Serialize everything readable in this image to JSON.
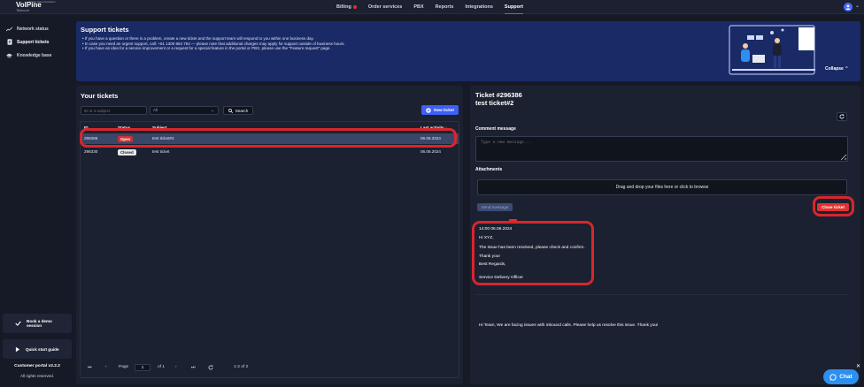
{
  "brand": {
    "name": "VolPine",
    "sub": "Telecom",
    "tag": "Smart Communication"
  },
  "nav": {
    "items": [
      {
        "label": "Billing",
        "dot": true
      },
      {
        "label": "Order services"
      },
      {
        "label": "PBX"
      },
      {
        "label": "Reports"
      },
      {
        "label": "Integrations"
      },
      {
        "label": "Support",
        "active": true
      }
    ]
  },
  "sidebar": {
    "items": [
      {
        "label": "Network status",
        "icon": "chart-line-icon"
      },
      {
        "label": "Support tickets",
        "icon": "ticket-icon",
        "active": true
      },
      {
        "label": "Knowledge base",
        "icon": "graduation-cap-icon"
      }
    ],
    "demo_label": "Book a demo session",
    "guide_label": "Quick start guide",
    "version": "Customer portal v2.2.2",
    "rights": "All rights reserved."
  },
  "banner": {
    "title": "Support tickets",
    "lines": [
      "If you have a question or there is a problem, create a new ticket and the support team will respond to you within one business day.",
      "In case you need an urgent support, call: +61 1300 864 754 — please note that additional charges may apply for support outside of business hours.",
      "If you have an idea for a service improvement or a request for a special feature in the portal or PBX, please use the \"Feature request\" page."
    ],
    "collapse_label": "Collapse"
  },
  "tickets": {
    "title": "Your tickets",
    "search_placeholder": "ID or a subject",
    "status_filter": "All",
    "search_label": "Search",
    "new_ticket_label": "New ticket",
    "columns": {
      "id": "ID",
      "status": "Status",
      "subject": "Subject",
      "last_activity": "Last activity"
    },
    "rows": [
      {
        "id": "296386",
        "status": "Open",
        "subject": "test ticket#2",
        "last_activity": "06.06.2024"
      },
      {
        "id": "296330",
        "status": "Closed",
        "subject": "test ticket",
        "last_activity": "06.06.2024"
      }
    ],
    "pager": {
      "page_label": "Page",
      "page": "1",
      "of_label": "of 1",
      "range": "1-2 of 2"
    }
  },
  "detail": {
    "ticket_id": "Ticket #296386",
    "subject": "test ticket#2",
    "comment_label": "Comment message",
    "comment_placeholder": "Type a new message...",
    "attachments_label": "Attachments",
    "dropzone_text": "Drag and drop your files here or click to browse",
    "send_label": "Send message",
    "close_label": "Close ticket",
    "reply": {
      "time": "14:00 06.06.2024",
      "greeting": "Hi XYZ,",
      "body": "The issue has been resolved, please check and confirm.",
      "thanks": "Thank you!",
      "regards": "Best Regards,",
      "signature": "Service Delivery Officer"
    },
    "original_message": "Hi Team, We are facing issues with inbound calls. Please help us resolve this issue. Thank you!"
  },
  "chat": {
    "label": "Chat"
  },
  "colors": {
    "accent": "#3e5ff5",
    "danger": "#e2322f",
    "annotation": "#d8262e",
    "banner": "#1a2a66"
  }
}
